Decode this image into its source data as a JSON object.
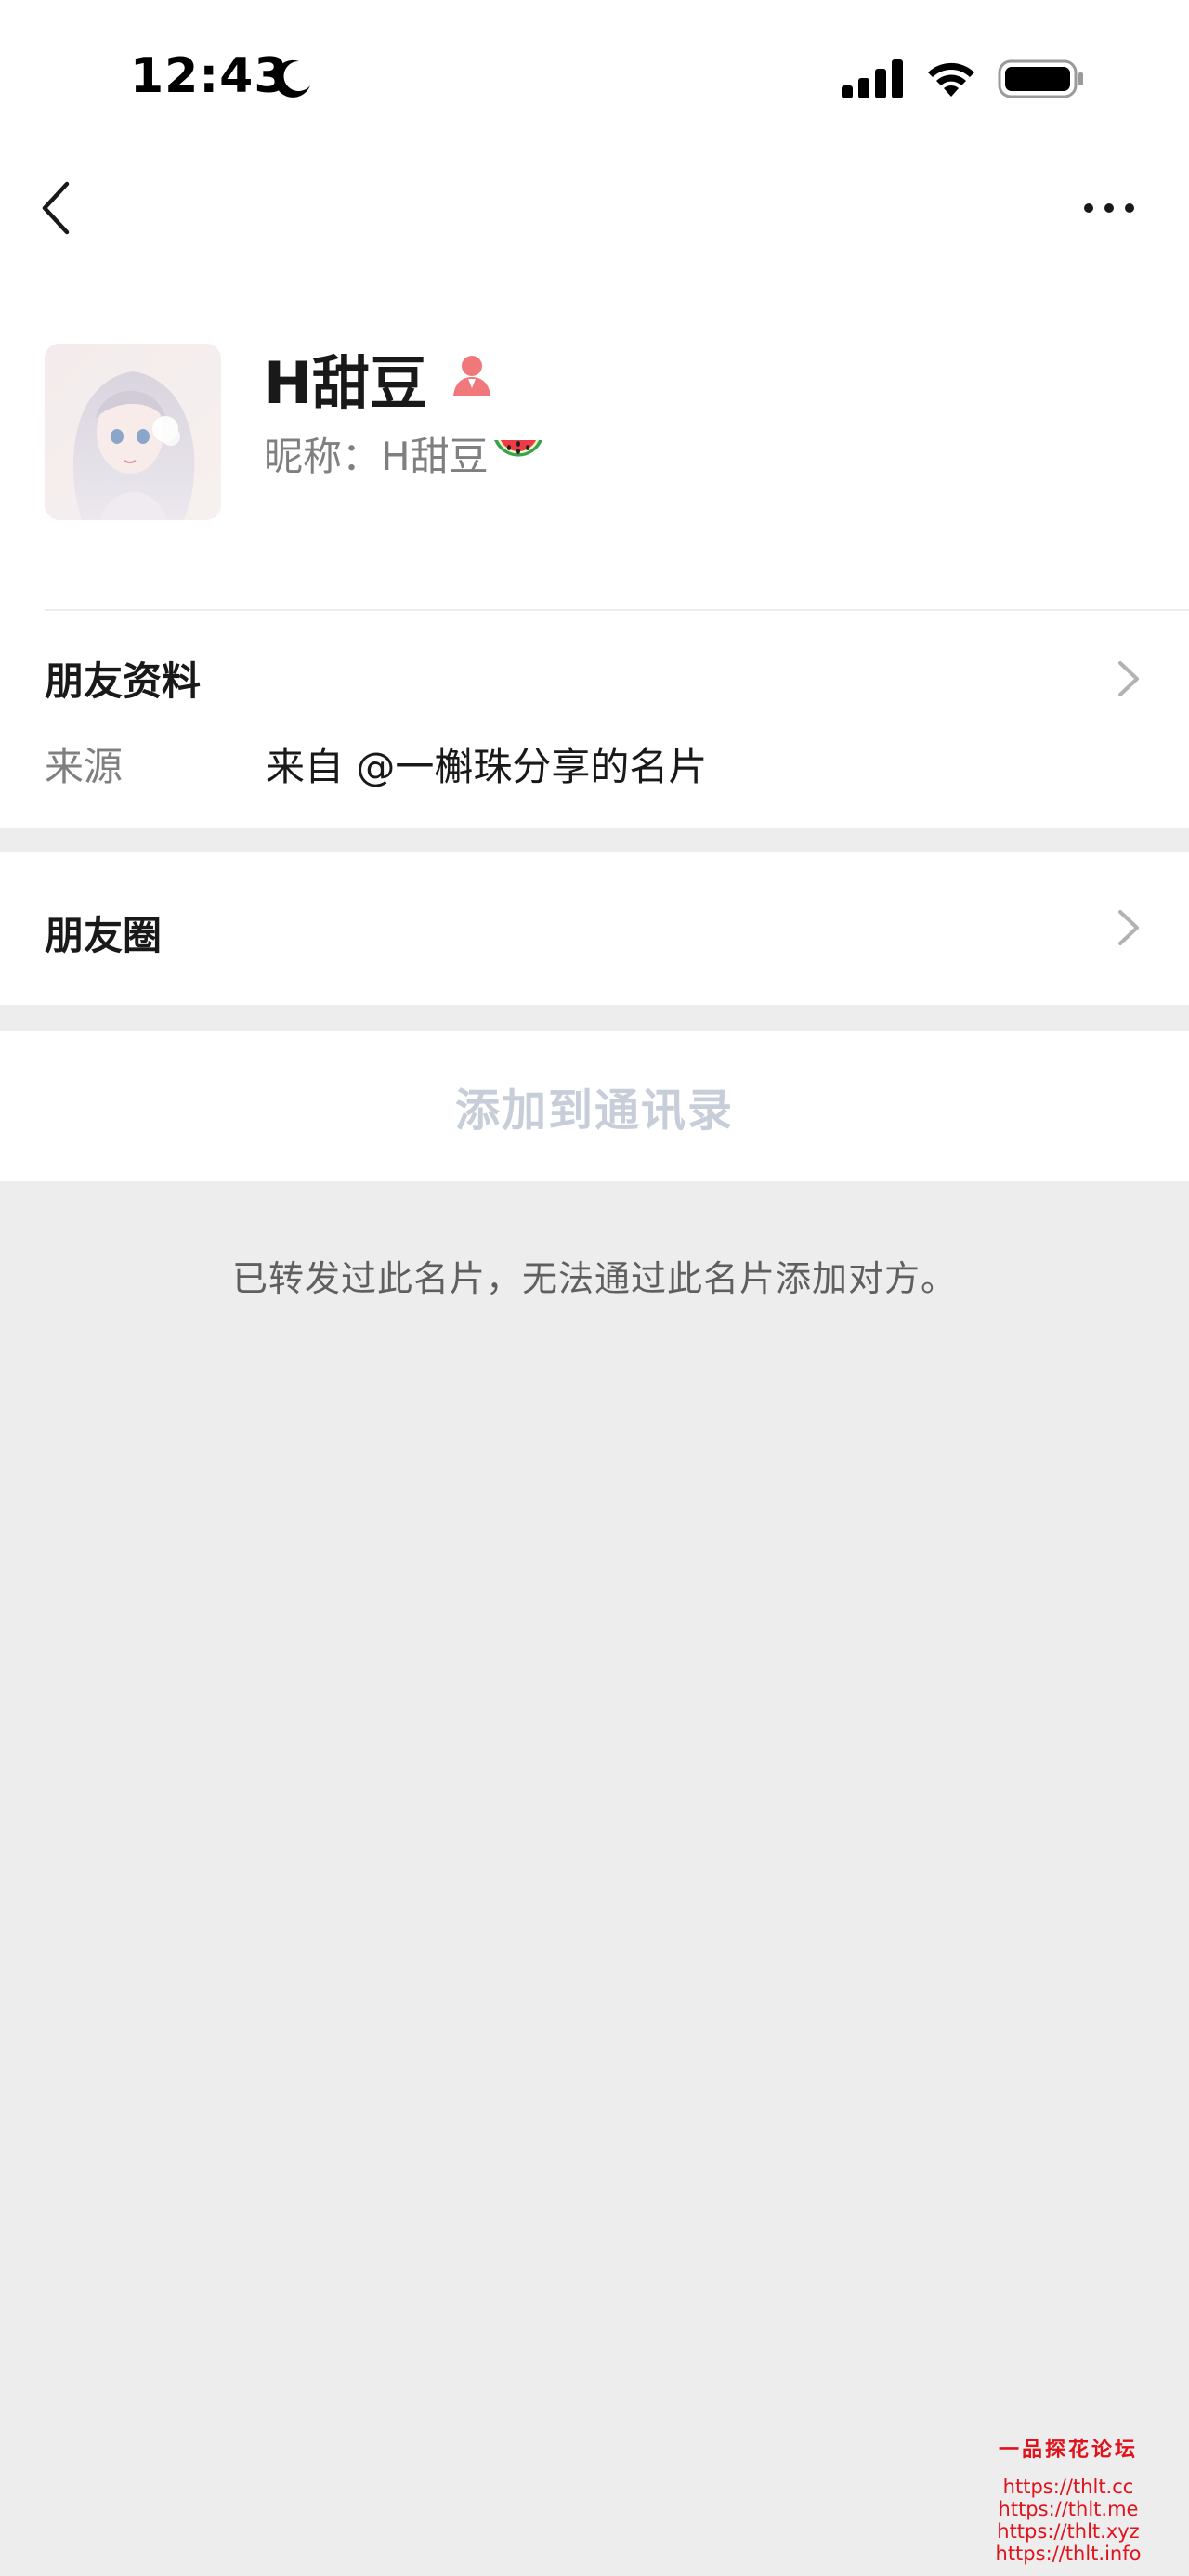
{
  "status_bar": {
    "time": "12:43",
    "icons": [
      "moon-icon",
      "signal-icon",
      "wifi-icon",
      "battery-icon"
    ]
  },
  "nav": {
    "back_icon": "chevron-left",
    "more_icon": "ellipsis"
  },
  "profile": {
    "display_name": "H甜豆",
    "gender_icon": "person-female",
    "nickname_label": "昵称：",
    "nickname_value": "H甜豆",
    "nickname_emoji_icon": "watermelon"
  },
  "friend_info": {
    "title": "朋友资料",
    "source_label": "来源",
    "source_value": "来自 @一槲珠分享的名片"
  },
  "moments": {
    "title": "朋友圈"
  },
  "actions": {
    "add_to_contacts": "添加到通讯录"
  },
  "notice": "已转发过此名片，无法通过此名片添加对方。",
  "watermark": {
    "title": "一品探花论坛",
    "links": [
      "https://thlt.cc",
      "https://thlt.me",
      "https://thlt.xyz",
      "https://thlt.info"
    ]
  },
  "colors": {
    "background": "#ededed",
    "card": "#ffffff",
    "primary_text": "#191919",
    "secondary_text": "#7f7f7f",
    "disabled_button": "#c7ced9",
    "gender_female": "#f0787a",
    "watermark_red": "#e0121b"
  }
}
